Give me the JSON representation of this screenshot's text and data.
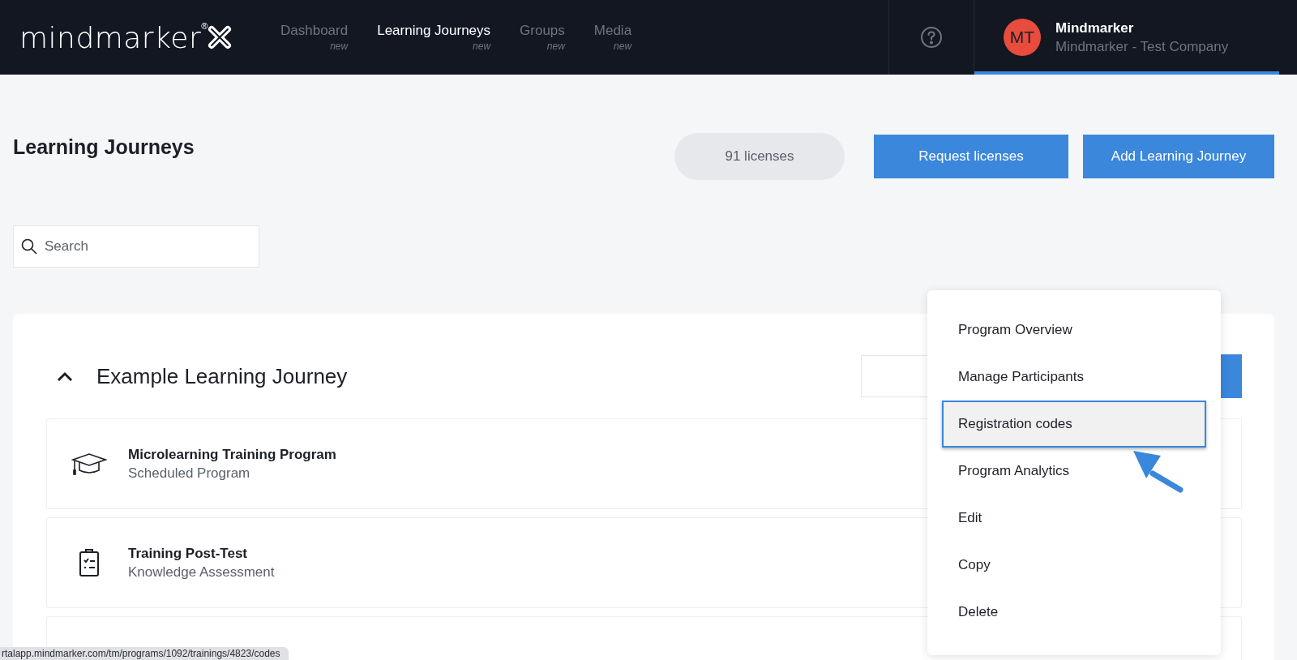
{
  "header": {
    "logo": {
      "text": "mindmarker",
      "mark": "®"
    },
    "nav": [
      {
        "label": "Dashboard",
        "badge": "new",
        "selected": false
      },
      {
        "label": "Learning Journeys",
        "badge": "new",
        "selected": true
      },
      {
        "label": "Groups",
        "badge": "new",
        "selected": false
      },
      {
        "label": "Media",
        "badge": "new",
        "selected": false
      }
    ],
    "user": {
      "initials": "MT",
      "name": "Mindmarker",
      "company": "Mindmarker - Test Company"
    }
  },
  "page": {
    "title": "Learning Journeys",
    "licenses": "91 licenses",
    "buttons": [
      "Request licenses",
      "Add Learning Journey"
    ]
  },
  "search": {
    "placeholder": "Search"
  },
  "journey": {
    "title": "Example Learning Journey",
    "expanded": true,
    "items": [
      {
        "kind": "program",
        "title": "Microlearning Training Program",
        "subtitle": "Scheduled Program"
      },
      {
        "kind": "assessment",
        "title": "Training Post-Test",
        "subtitle": "Knowledge Assessment"
      }
    ]
  },
  "menu": {
    "items": [
      {
        "label": "Program Overview",
        "selected": false
      },
      {
        "label": "Manage Participants",
        "selected": false
      },
      {
        "label": "Registration codes",
        "selected": true
      },
      {
        "label": "Program Analytics",
        "selected": false
      },
      {
        "label": "Edit",
        "selected": false
      },
      {
        "label": "Copy",
        "selected": false
      },
      {
        "label": "Delete",
        "selected": false
      }
    ]
  },
  "status_bar": {
    "url": "rtalapp.mindmarker.com/tm/programs/1092/trainings/4823/codes"
  }
}
